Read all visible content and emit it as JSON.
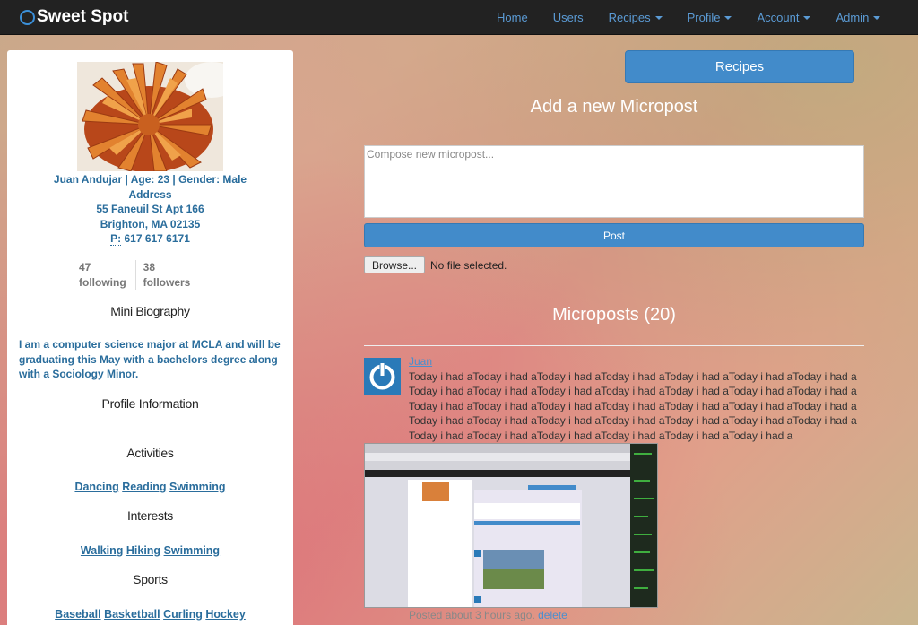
{
  "navbar": {
    "brand": "Sweet Spot",
    "items": [
      {
        "label": "Home",
        "dropdown": false
      },
      {
        "label": "Users",
        "dropdown": false
      },
      {
        "label": "Recipes",
        "dropdown": true
      },
      {
        "label": "Profile",
        "dropdown": true
      },
      {
        "label": "Account",
        "dropdown": true
      },
      {
        "label": "Admin",
        "dropdown": true
      }
    ]
  },
  "profile": {
    "name_line": "Juan Andujar | Age: 23 | Gender: Male",
    "address_label": "Address",
    "street": "55 Faneuil St Apt 166",
    "city": "Brighton, MA 02135",
    "phone_label": "P:",
    "phone": "617 617 6171",
    "following_count": "47",
    "following_label": "following",
    "followers_count": "38",
    "followers_label": "followers",
    "bio_title": "Mini Biography",
    "bio": "I am a computer science major at MCLA and will be graduating this May with a bachelors degree along with a Sociology Minor.",
    "info_title": "Profile Information",
    "activities_title": "Activities",
    "activities": [
      "Dancing",
      "Reading",
      "Swimming"
    ],
    "interests_title": "Interests",
    "interests": [
      "Walking",
      "Hiking",
      "Swimming"
    ],
    "sports_title": "Sports",
    "sports": [
      "Baseball",
      "Basketball",
      "Curling",
      "Hockey"
    ]
  },
  "main": {
    "recipes_button": "Recipes",
    "add_title": "Add a new Micropost",
    "compose_placeholder": "Compose new micropost...",
    "post_button": "Post",
    "browse_button": "Browse...",
    "file_status": "No file selected.",
    "microposts_title": "Microposts (20)",
    "post": {
      "user": "Juan",
      "content": "Today i had aToday i had aToday i had aToday i had aToday i had aToday i had aToday i had aToday i had aToday i had aToday i had aToday i had aToday i had aToday i had aToday i had aToday i had aToday i had aToday i had aToday i had aToday i had aToday i had aToday i had aToday i had aToday i had aToday i had aToday i had aToday i had aToday i had aToday i had aToday i had aToday i had aToday i had aToday i had aToday i had aToday i had a",
      "timestamp": "Posted about 3 hours ago.",
      "delete_label": "delete"
    }
  },
  "colors": {
    "navbar_bg": "#222222",
    "brand_accent": "#3b8fd8",
    "primary_button": "#428bca",
    "link": "#2a6d9c"
  }
}
